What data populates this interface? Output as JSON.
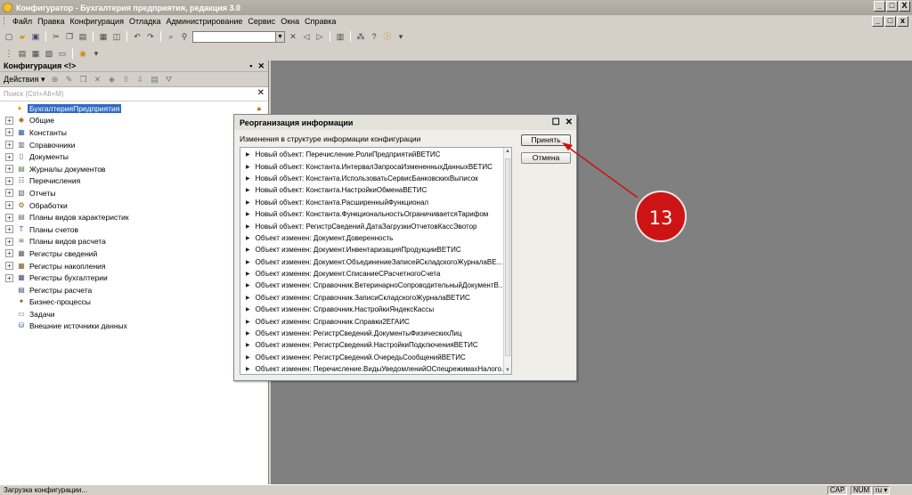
{
  "window": {
    "title": "Конфигуратор - Бухгалтерия предприятия, редакция 3.0",
    "buttons": [
      "_",
      "□",
      "X"
    ]
  },
  "menu": [
    "Файл",
    "Правка",
    "Конфигурация",
    "Отладка",
    "Администрирование",
    "Сервис",
    "Окна",
    "Справка"
  ],
  "left_panel": {
    "title": "Конфигурация <!>",
    "actions_label": "Действия",
    "search_placeholder": "Поиск (Ctrl+Alt+M)",
    "root": "БухгалтерияПредприятия",
    "items": [
      {
        "label": "Общие",
        "icon": "shapes-icon",
        "expandable": true
      },
      {
        "label": "Константы",
        "icon": "constants-icon",
        "expandable": true
      },
      {
        "label": "Справочники",
        "icon": "catalog-icon",
        "expandable": true
      },
      {
        "label": "Документы",
        "icon": "document-icon",
        "expandable": true
      },
      {
        "label": "Журналы документов",
        "icon": "journal-icon",
        "expandable": true
      },
      {
        "label": "Перечисления",
        "icon": "enum-icon",
        "expandable": true
      },
      {
        "label": "Отчеты",
        "icon": "report-icon",
        "expandable": true
      },
      {
        "label": "Обработки",
        "icon": "processing-icon",
        "expandable": true
      },
      {
        "label": "Планы видов характеристик",
        "icon": "chart-characteristics-icon",
        "expandable": true
      },
      {
        "label": "Планы счетов",
        "icon": "chart-accounts-icon",
        "expandable": true
      },
      {
        "label": "Планы видов расчета",
        "icon": "calc-types-icon",
        "expandable": true
      },
      {
        "label": "Регистры сведений",
        "icon": "info-register-icon",
        "expandable": true
      },
      {
        "label": "Регистры накопления",
        "icon": "accum-register-icon",
        "expandable": true
      },
      {
        "label": "Регистры бухгалтерии",
        "icon": "accounting-register-icon",
        "expandable": true
      },
      {
        "label": "Регистры расчета",
        "icon": "calc-register-icon",
        "expandable": false
      },
      {
        "label": "Бизнес-процессы",
        "icon": "business-process-icon",
        "expandable": false
      },
      {
        "label": "Задачи",
        "icon": "task-icon",
        "expandable": false
      },
      {
        "label": "Внешние источники данных",
        "icon": "external-source-icon",
        "expandable": false
      }
    ]
  },
  "dialog": {
    "title": "Реорганизация информации",
    "subtitle": "Изменения в структуре информации конфигурации",
    "accept_label": "Принять",
    "cancel_label": "Отмена",
    "changes": [
      "Новый объект: Перечисление.РолиПредприятийВЕТИС",
      "Новый объект: Константа.ИнтервалЗапросаИзмененныхДанныхВЕТИС",
      "Новый объект: Константа.ИспользоватьСервисБанковскихВыписок",
      "Новый объект: Константа.НастройкиОбменаВЕТИС",
      "Новый объект: Константа.РасширенныйФункционал",
      "Новый объект: Константа.ФункциональностьОграничиваетсяТарифом",
      "Новый объект: РегистрСведений.ДатаЗагрузкиОтчетовКассЭвотор",
      "Объект изменен: Документ.Доверенность",
      "Объект изменен: Документ.ИнвентаризацияПродукцииВЕТИС",
      "Объект изменен: Документ.ОбъединениеЗаписейСкладскогоЖурналаВЕ...",
      "Объект изменен: Документ.СписаниеСРасчетногоСчета",
      "Объект изменен: Справочник.ВетеринарноСопроводительныйДокументВ...",
      "Объект изменен: Справочник.ЗаписиСкладскогоЖурналаВЕТИС",
      "Объект изменен: Справочник.НастройкиЯндексКассы",
      "Объект изменен: Справочник.Справки2ЕГАИС",
      "Объект изменен: РегистрСведений.ДокументыФизическихЛиц",
      "Объект изменен: РегистрСведений.НастройкиПодключенияВЕТИС",
      "Объект изменен: РегистрСведений.ОчередьСообщенийВЕТИС",
      "Объект изменен: Перечисление.ВидыУведомленийОСпецрежимахНалого..."
    ]
  },
  "annotation": {
    "number": "13",
    "color": "#cc1414"
  },
  "statusbar": {
    "text": "Загрузка конфигурации...",
    "cap": "CAP",
    "num": "NUM",
    "lang": "ru"
  }
}
